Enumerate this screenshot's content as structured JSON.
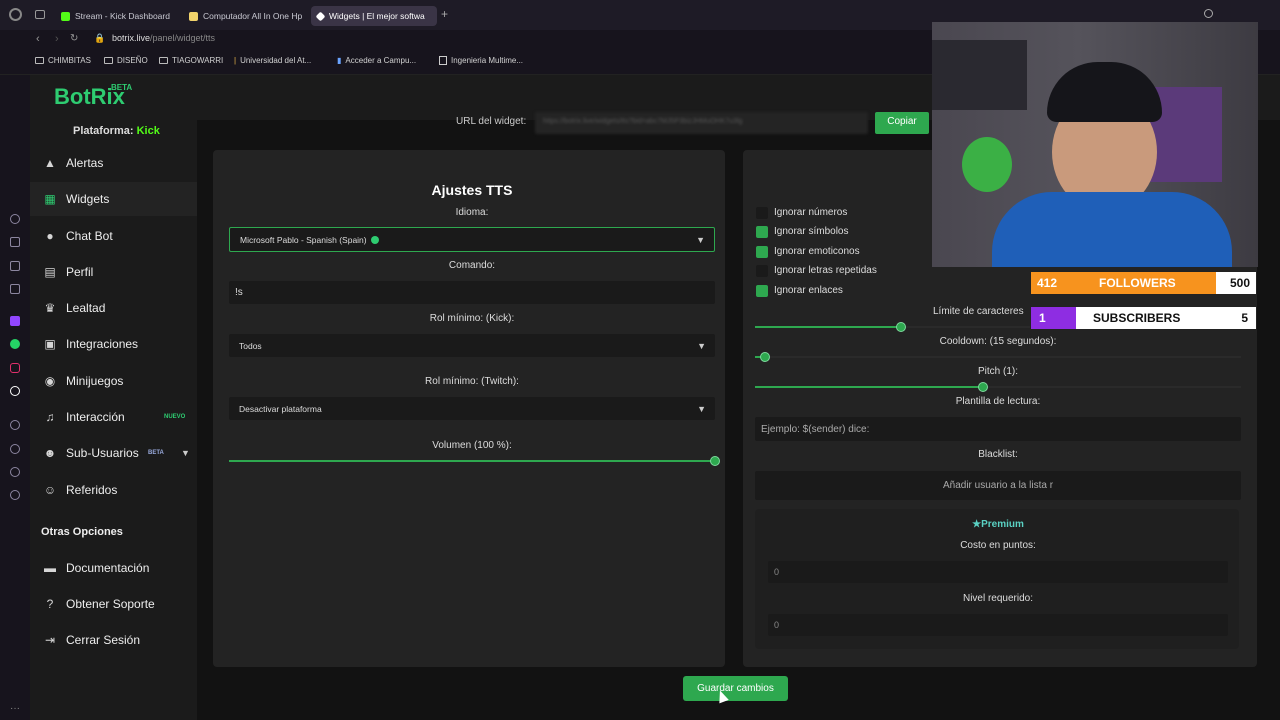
{
  "browser": {
    "tabs": [
      {
        "title": "Stream - Kick Dashboard",
        "color": "#53fc18"
      },
      {
        "title": "Computador All In One Hp",
        "color": "#f1d36b"
      },
      {
        "title": "Widgets | El mejor softwa",
        "color": "#ffffff"
      }
    ],
    "address_path_host": "botrix.live",
    "address_path_rest": "/panel/widget/tts",
    "bookmarks": [
      "CHIMBITAS",
      "DISEÑO",
      "TIAGOWARRI",
      "Universidad del At...",
      "Acceder a Campu...",
      "Ingenieria Multime..."
    ]
  },
  "sidebar": {
    "logo": "BotRix",
    "logo_badge": "BETA",
    "platform_label": "Plataforma:",
    "platform_value": "Kick",
    "items": [
      {
        "label": "Alertas",
        "icon": "warning-icon"
      },
      {
        "label": "Widgets",
        "icon": "grid-icon",
        "active": true
      },
      {
        "label": "Chat Bot",
        "icon": "bot-icon"
      },
      {
        "label": "Perfil",
        "icon": "id-card-icon"
      },
      {
        "label": "Lealtad",
        "icon": "trophy-icon"
      },
      {
        "label": "Integraciones",
        "icon": "integrations-icon"
      },
      {
        "label": "Minijuegos",
        "icon": "gamepad-icon"
      },
      {
        "label": "Interacción",
        "icon": "music-icon",
        "badge": "NUEVO"
      },
      {
        "label": "Sub-Usuarios",
        "icon": "users-icon",
        "badge": "BETA"
      },
      {
        "label": "Referidos",
        "icon": "referrals-icon"
      }
    ],
    "other_title": "Otras Opciones",
    "other_items": [
      {
        "label": "Documentación",
        "icon": "document-icon"
      },
      {
        "label": "Obtener Soporte",
        "icon": "help-icon"
      },
      {
        "label": "Cerrar Sesión",
        "icon": "logout-icon"
      }
    ]
  },
  "widget_url": {
    "label": "URL del widget:",
    "value": "https://botrix.live/widgets/tts?bid=abc7MJ5P3bizJHMuOHK7u3lg",
    "copy_label": "Copiar"
  },
  "tts": {
    "title": "Ajustes TTS",
    "language_label": "Idioma:",
    "language_value": "Microsoft Pablo - Spanish (Spain)",
    "command_label": "Comando:",
    "command_value": "!s",
    "role_kick_label": "Rol mínimo: (Kick):",
    "role_kick_value": "Todos",
    "role_twitch_label": "Rol mínimo: (Twitch):",
    "role_twitch_value": "Desactivar plataforma",
    "volume_label": "Volumen (100 %):",
    "volume_value": 1.0
  },
  "right_panel": {
    "checkboxes": [
      {
        "label": "Ignorar números",
        "checked": false
      },
      {
        "label": "Ignorar símbolos",
        "checked": true
      },
      {
        "label": "Ignorar emoticonos",
        "checked": true
      },
      {
        "label": "Ignorar letras repetidas",
        "checked": false
      },
      {
        "label": "Ignorar enlaces",
        "checked": true
      }
    ],
    "char_limit_label": "Límite de caracteres",
    "char_limit_value": 0.3,
    "cooldown_label": "Cooldown: (15 segundos):",
    "cooldown_value": 0.02,
    "pitch_label": "Pitch (1):",
    "pitch_value": 0.47,
    "template_label": "Plantilla de lectura:",
    "template_placeholder": "Ejemplo: $(sender) dice:",
    "blacklist_label": "Blacklist:",
    "blacklist_placeholder": "Añadir usuario a la lista r",
    "premium_title": "Premium",
    "cost_label": "Costo en puntos:",
    "cost_value": "0",
    "level_label": "Nivel requerido:",
    "level_value": "0"
  },
  "save_label": "Guardar cambios",
  "overlay": {
    "followers_current": "412",
    "followers_label": "FOLLOWERS",
    "followers_goal": "500",
    "followers_progress": 0.824,
    "subs_current": "1",
    "subs_label": "SUBSCRIBERS",
    "subs_goal": "5",
    "subs_progress": 0.2
  },
  "colors": {
    "accent": "#2ea84f",
    "kick": "#53fc18",
    "followers": "#f7931e",
    "subs": "#8e2de2"
  }
}
